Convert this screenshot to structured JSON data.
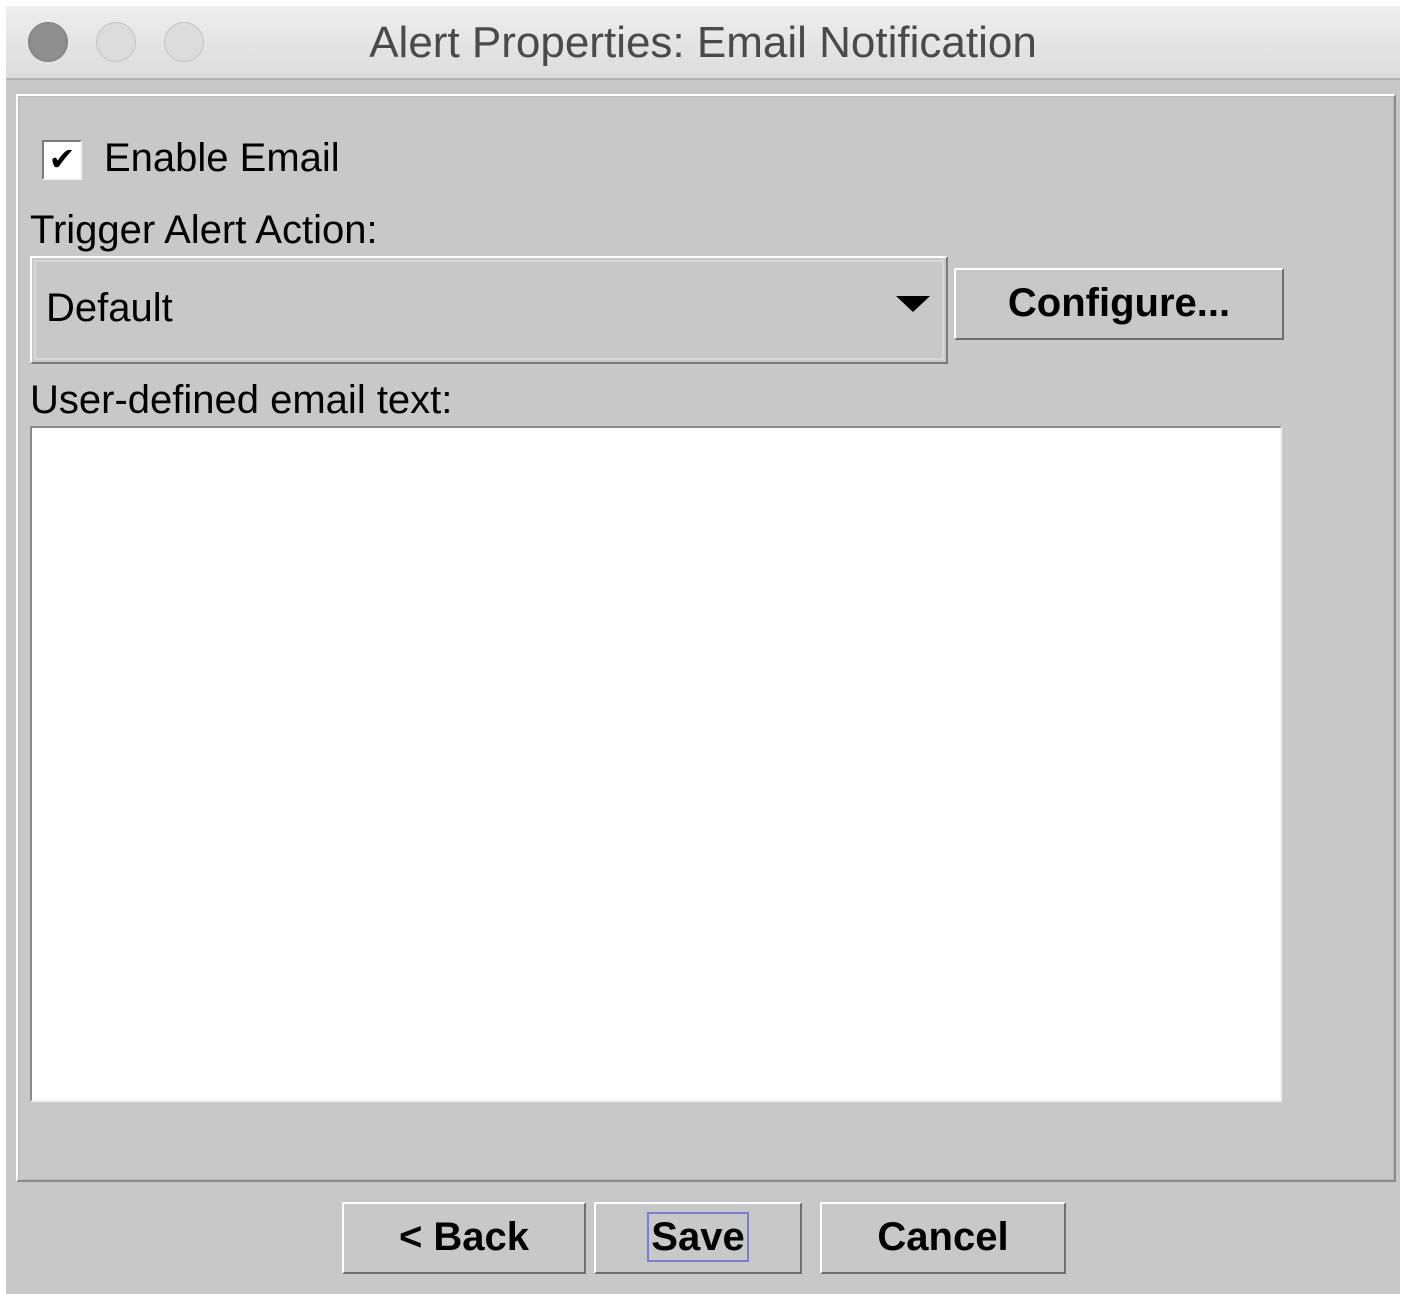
{
  "window": {
    "title": "Alert Properties: Email Notification"
  },
  "email": {
    "enable_label": "Enable Email",
    "enable_checked": true,
    "checkmark": "✔",
    "trigger_label": "Trigger Alert Action:",
    "trigger_value": "Default",
    "configure_label": "Configure...",
    "text_label": "User-defined email text:",
    "text_value": ""
  },
  "footer": {
    "back_label": "< Back",
    "save_label": "Save",
    "cancel_label": "Cancel"
  },
  "colors": {
    "window_bg": "#c8c8c8",
    "focus_ring": "#7c7cd0"
  }
}
